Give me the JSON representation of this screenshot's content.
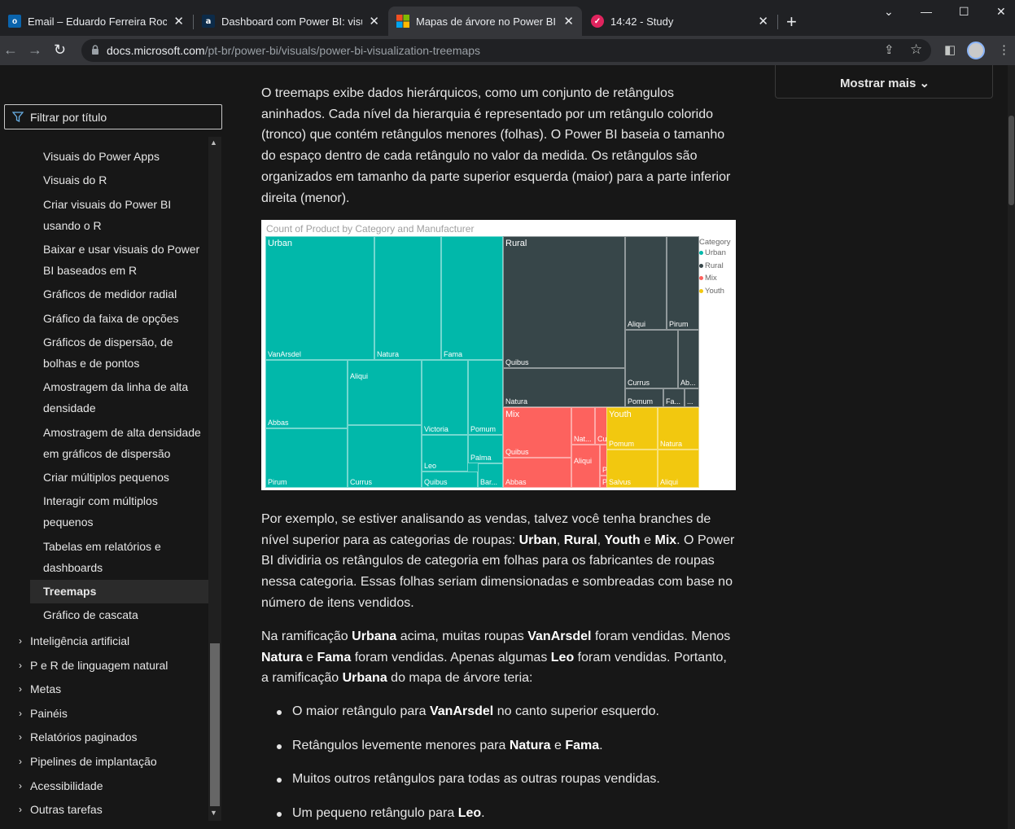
{
  "browser": {
    "tabs": [
      {
        "title": "Email – Eduardo Ferreira Rocha – ",
        "icon": "outlook-icon"
      },
      {
        "title": "Dashboard com Power BI: visualiz",
        "icon": "alura-icon"
      },
      {
        "title": "Mapas de árvore no Power BI - P",
        "icon": "microsoft-icon",
        "active": true
      },
      {
        "title": "14:42 - Study",
        "icon": "study-check-icon"
      }
    ],
    "url_host": "docs.microsoft.com",
    "url_path": "/pt-br/power-bi/visuals/power-bi-visualization-treemaps"
  },
  "sidebar": {
    "filter_placeholder": "Filtrar por título",
    "items": [
      {
        "label": "Visuais do Power Apps"
      },
      {
        "label": "Visuais do R"
      },
      {
        "label": "Criar visuais do Power BI usando o R"
      },
      {
        "label": "Baixar e usar visuais do Power BI baseados em R"
      },
      {
        "label": "Gráficos de medidor radial"
      },
      {
        "label": "Gráfico da faixa de opções"
      },
      {
        "label": "Gráficos de dispersão, de bolhas e de pontos"
      },
      {
        "label": "Amostragem da linha de alta densidade"
      },
      {
        "label": "Amostragem de alta densidade em gráficos de dispersão"
      },
      {
        "label": "Criar múltiplos pequenos"
      },
      {
        "label": "Interagir com múltiplos pequenos"
      },
      {
        "label": "Tabelas em relatórios e dashboards"
      },
      {
        "label": "Treemaps",
        "active": true
      },
      {
        "label": "Gráfico de cascata"
      }
    ],
    "groups": [
      {
        "label": "Inteligência artificial"
      },
      {
        "label": "P e R de linguagem natural"
      },
      {
        "label": "Metas"
      },
      {
        "label": "Painéis"
      },
      {
        "label": "Relatórios paginados"
      },
      {
        "label": "Pipelines de implantação"
      },
      {
        "label": "Acessibilidade"
      },
      {
        "label": "Outras tarefas"
      }
    ]
  },
  "right_panel": {
    "show_more": "Mostrar mais"
  },
  "article": {
    "intro": "O treemaps exibe dados hierárquicos, como um conjunto de retângulos aninhados. Cada nível da hierarquia é representado por um retângulo colorido (tronco) que contém retângulos menores (folhas). O Power BI baseia o tamanho do espaço dentro de cada retângulo no valor da medida. Os retângulos são organizados em tamanho da parte superior esquerda (maior) para a parte inferior direita (menor).",
    "p2": {
      "a": "Por exemplo, se estiver analisando as vendas, talvez você tenha branches de nível superior para as categorias de roupas: ",
      "b1": "Urban",
      "s1": ", ",
      "b2": "Rural",
      "s2": ", ",
      "b3": "Youth",
      "s3": " e ",
      "b4": "Mix",
      "c": ". O Power BI dividiria os retângulos de categoria em folhas para os fabricantes de roupas nessa categoria. Essas folhas seriam dimensionadas e sombreadas com base no número de itens vendidos."
    },
    "p3": {
      "a": "Na ramificação ",
      "b1": "Urbana",
      "s1": " acima, muitas roupas ",
      "b2": "VanArsdel",
      "s2": " foram vendidas. Menos ",
      "b3": "Natura",
      "s3": " e ",
      "b4": "Fama",
      "s4": " foram vendidas. Apenas algumas ",
      "b5": "Leo",
      "s5": " foram vendidas. Portanto, a ramificação ",
      "b6": "Urbana",
      "c": " do mapa de árvore teria:"
    },
    "bullets": [
      {
        "a": "O maior retângulo para ",
        "b": "VanArsdel",
        "c": " no canto superior esquerdo."
      },
      {
        "a": "Retângulos levemente menores para ",
        "b": "Natura",
        "m": " e ",
        "b2": "Fama",
        "c": "."
      },
      {
        "a": "Muitos outros retângulos para todas as outras roupas vendidas."
      },
      {
        "a": "Um pequeno retângulo para ",
        "b": "Leo",
        "c": "."
      }
    ]
  },
  "chart_data": {
    "type": "treemap",
    "title": "Count of Product by Category and Manufacturer",
    "legend_title": "Category",
    "legend_position": "right",
    "categories": [
      {
        "name": "Urban",
        "color": "#01b8aa",
        "leaves": [
          "VanArsdel",
          "Natura",
          "Fama",
          "Abbas",
          "Aliqui",
          "Victoria",
          "Pomum",
          "Leo",
          "Palma",
          "Pirum",
          "Currus",
          "Quibus",
          "Bar..."
        ]
      },
      {
        "name": "Rural",
        "color": "#374649",
        "leaves": [
          "Quibus",
          "Natura",
          "Aliqui",
          "Pirum",
          "Currus",
          "Ab...",
          "Pomum",
          "Fa...",
          "..."
        ]
      },
      {
        "name": "Mix",
        "color": "#fd625e",
        "leaves": [
          "Quibus",
          "Abbas",
          "Nat...",
          "Cu...",
          "Aliqui",
          "Pirum",
          "P...",
          "..."
        ]
      },
      {
        "name": "Youth",
        "color": "#f2c80f",
        "leaves": [
          "Pomum",
          "Natura",
          "Aliqui",
          "Salvus"
        ]
      }
    ]
  }
}
